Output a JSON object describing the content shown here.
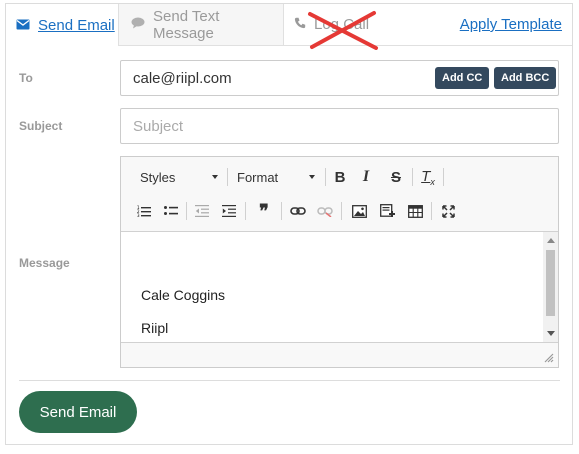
{
  "tabs": {
    "email": "Send Email",
    "text": "Send Text Message",
    "call": "Log Call",
    "apply_template": "Apply Template"
  },
  "form": {
    "to_label": "To",
    "to_value": "cale@riipl.com",
    "add_cc": "Add CC",
    "add_bcc": "Add BCC",
    "subject_label": "Subject",
    "subject_placeholder": "Subject",
    "message_label": "Message"
  },
  "toolbar": {
    "styles": "Styles",
    "format": "Format",
    "bold": "B",
    "italic": "I",
    "strike": "S",
    "remove_format": "T",
    "blockquote": "❞"
  },
  "message": {
    "line1": "Cale Coggins",
    "line2": "Riipl"
  },
  "actions": {
    "send": "Send Email"
  },
  "colors": {
    "link": "#1a6fc2",
    "dark_button": "#34495e",
    "send_button": "#2e6e4f",
    "cross": "#e53935"
  }
}
